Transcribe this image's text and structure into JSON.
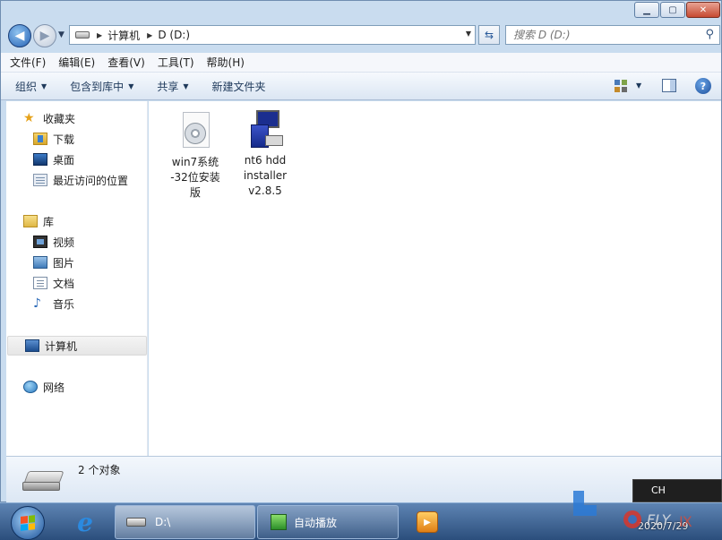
{
  "window": {
    "caption_buttons": {
      "minimize_icon": "minimize-icon",
      "maximize_icon": "maximize-icon",
      "close_icon": "close-icon"
    }
  },
  "navbar": {
    "breadcrumb": [
      "计算机",
      "D (D:)"
    ],
    "search_placeholder": "搜索 D (D:)",
    "icons": {
      "back": "back-arrow-icon",
      "forward": "forward-arrow-icon",
      "refresh": "refresh-icon",
      "search": "search-icon"
    }
  },
  "menu": [
    "文件(F)",
    "编辑(E)",
    "查看(V)",
    "工具(T)",
    "帮助(H)"
  ],
  "commands": [
    "组织",
    "包含到库中",
    "共享",
    "新建文件夹"
  ],
  "help_label": "?",
  "navpane": {
    "favorites": {
      "label": "收藏夹",
      "items": [
        "下载",
        "桌面",
        "最近访问的位置"
      ]
    },
    "libraries": {
      "label": "库",
      "items": [
        "视频",
        "图片",
        "文档",
        "音乐"
      ]
    },
    "computer": {
      "label": "计算机",
      "selected": true
    },
    "network": {
      "label": "网络"
    }
  },
  "files": [
    {
      "name_lines": [
        "win7系统",
        "-32位安装",
        "版"
      ],
      "icon": "disc-image-icon"
    },
    {
      "name_lines": [
        "nt6 hdd",
        "installer",
        "v2.8.5"
      ],
      "icon": "installer-app-icon"
    }
  ],
  "details": {
    "count_text": "2 个对象"
  },
  "taskbar": {
    "items": [
      {
        "label": "D:\\",
        "active": true
      },
      {
        "label": "自动播放",
        "active": false
      }
    ]
  },
  "tray": {
    "lang": "CH",
    "date": "2020/7/29"
  },
  "colors": {
    "accent": "#2461b5",
    "taskbar": "#2b4e7c",
    "selection": "#e6e6e6"
  }
}
